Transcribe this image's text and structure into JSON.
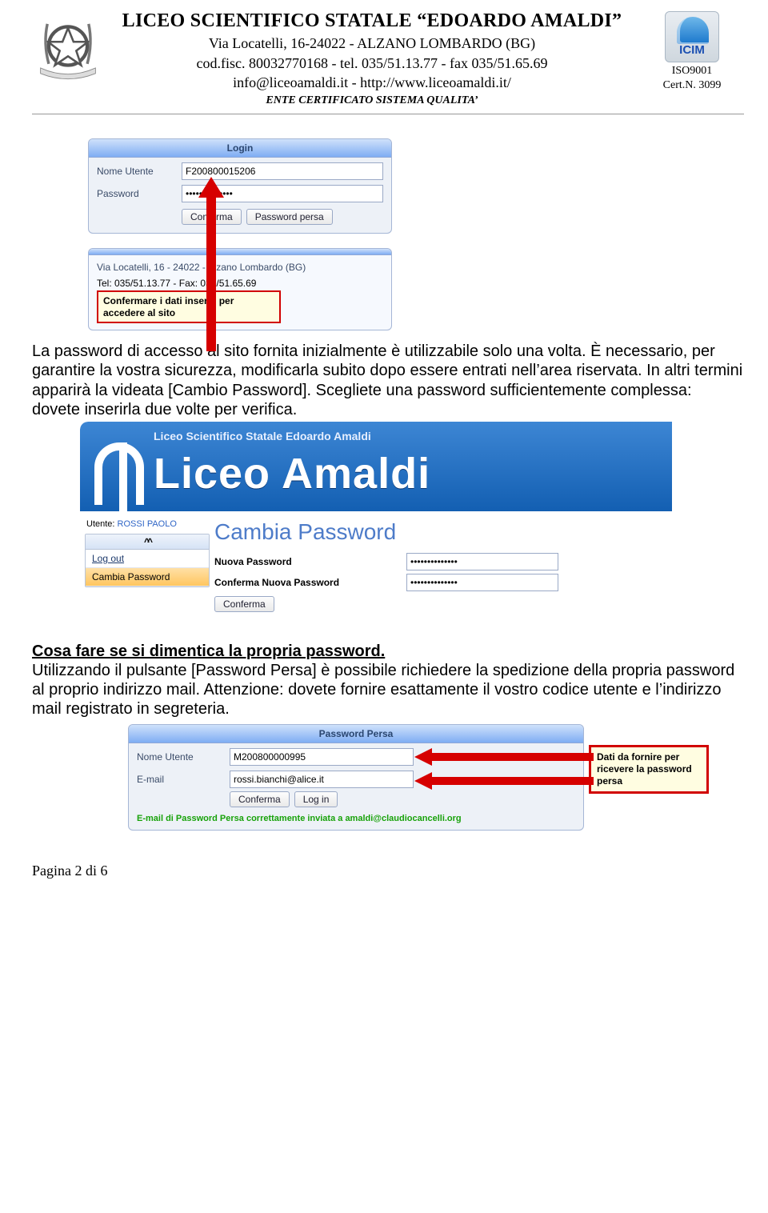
{
  "header": {
    "title": "LICEO SCIENTIFICO STATALE “EDOARDO AMALDI”",
    "address": "Via Locatelli, 16-24022 - ALZANO LOMBARDO (BG)",
    "contact1": "cod.fisc. 80032770168 - tel. 035/51.13.77 - fax 035/51.65.69",
    "contact2": "info@liceoamaldi.it - http://www.liceoamaldi.it/",
    "ente": "ENTE CERTIFICATO SISTEMA QUALITA’",
    "cert": {
      "logo_text": "ICIM",
      "line1": "ISO9001",
      "line2": "Cert.N.  3099"
    }
  },
  "fig1": {
    "login_title": "Login",
    "user_label": "Nome Utente",
    "user_value": "F200800015206",
    "pw_label": "Password",
    "pw_value": "••••••••••••••",
    "btn_confirm": "Conferma",
    "btn_lost": "Password persa",
    "address_line": "Via Locatelli, 16 - 24022 - Alzano Lombardo (BG)",
    "tel_line": "Tel: 035/51.13.77 - Fax: 035/51.65.69",
    "tooltip_l1": "Confermare i dati inseriti per",
    "tooltip_l2": "accedere al sito"
  },
  "para1": "La password di accesso al sito fornita inizialmente è utilizzabile solo una volta. È necessario, per garantire la vostra sicurezza, modificarla subito dopo essere entrati nell’area riservata. In altri termini apparirà la videata [Cambio Password]. Scegliete una password sufficientemente complessa: dovete inserirla due volte per verifica.",
  "fig2": {
    "banner_small": "Liceo Scientifico Statale Edoardo Amaldi",
    "banner_big": "Liceo Amaldi",
    "user_label": "Utente:",
    "user_name": "ROSSI PAOLO",
    "sidebar": [
      {
        "label": "Log out",
        "active": false
      },
      {
        "label": "Cambia Password",
        "active": true
      }
    ],
    "main_heading": "Cambia Password",
    "new_pw_label": "Nuova Password",
    "new_pw_value": "••••••••••••••",
    "confirm_pw_label": "Conferma Nuova Password",
    "confirm_pw_value": "••••••••••••••",
    "btn_confirm": "Conferma"
  },
  "sec2_heading": "Cosa fare se si dimentica la propria password.",
  "para2": "Utilizzando il pulsante [Password Persa] è possibile richiedere la spedizione della propria password al proprio indirizzo mail. Attenzione: dovete fornire esattamente il vostro codice utente e l’indirizzo mail registrato in segreteria.",
  "fig3": {
    "panel_title": "Password Persa",
    "user_label": "Nome Utente",
    "user_value": "M200800000995",
    "email_label": "E-mail",
    "email_value": "rossi.bianchi@alice.it",
    "btn_confirm": "Conferma",
    "btn_login": "Log in",
    "status_msg": "E-mail di Password Persa correttamente inviata a amaldi@claudiocancelli.org",
    "callout": "Dati da fornire per ricevere la password persa"
  },
  "pagenum": "Pagina 2 di 6"
}
